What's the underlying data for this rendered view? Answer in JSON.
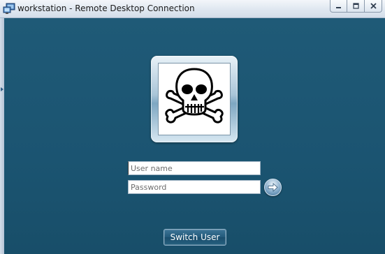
{
  "window": {
    "title": "workstation - Remote Desktop Connection",
    "app_icon": "remote-desktop-icon",
    "caption_buttons": [
      "minimize",
      "maximize",
      "close"
    ]
  },
  "login": {
    "user_tile_image": "skull-crossbones",
    "username": {
      "value": "",
      "placeholder": "User name"
    },
    "password": {
      "value": "",
      "placeholder": "Password"
    },
    "submit_icon": "arrow-right-icon",
    "switch_user_label": "Switch User"
  },
  "colors": {
    "background": "#1e5672",
    "titlebar": "#dfe7f0",
    "button": "#22597a"
  }
}
